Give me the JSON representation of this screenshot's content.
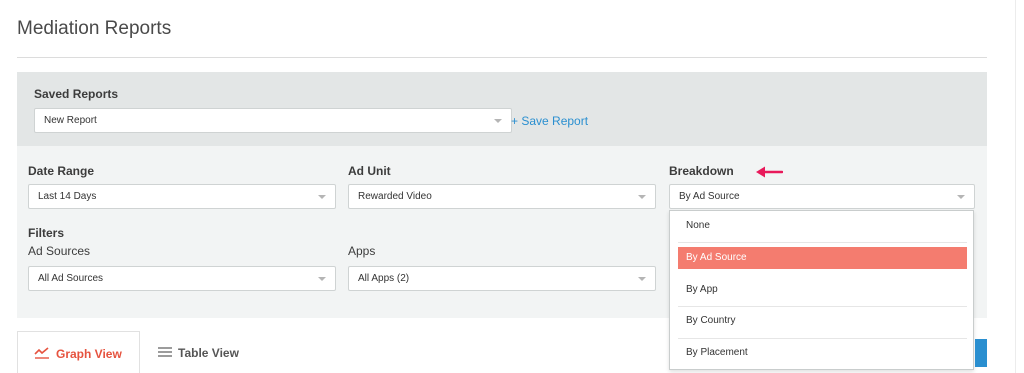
{
  "page": {
    "title": "Mediation Reports"
  },
  "saved_reports": {
    "label": "Saved Reports",
    "selected": "New Report",
    "save_link": "+ Save Report"
  },
  "filters": {
    "date_range": {
      "label": "Date Range",
      "selected": "Last 14 Days"
    },
    "ad_unit": {
      "label": "Ad Unit",
      "selected": "Rewarded Video"
    },
    "breakdown": {
      "label": "Breakdown",
      "selected": "By Ad Source",
      "options": [
        "None",
        "By Ad Source",
        "By App",
        "By Country",
        "By Placement"
      ]
    },
    "section_label": "Filters",
    "ad_sources": {
      "label": "Ad Sources",
      "selected": "All Ad Sources"
    },
    "apps": {
      "label": "Apps",
      "selected": "All Apps (2)"
    }
  },
  "view_tabs": {
    "graph": "Graph View",
    "table": "Table View",
    "active": "Graph View"
  },
  "colors": {
    "accent": "#e6533f",
    "selected_option": "#f47c6f",
    "link": "#2a8fd0",
    "annotation_arrow": "#e8195a"
  },
  "icons": {
    "graph": "line-chart-icon",
    "table": "list-icon",
    "annotation": "arrow-left-icon"
  }
}
